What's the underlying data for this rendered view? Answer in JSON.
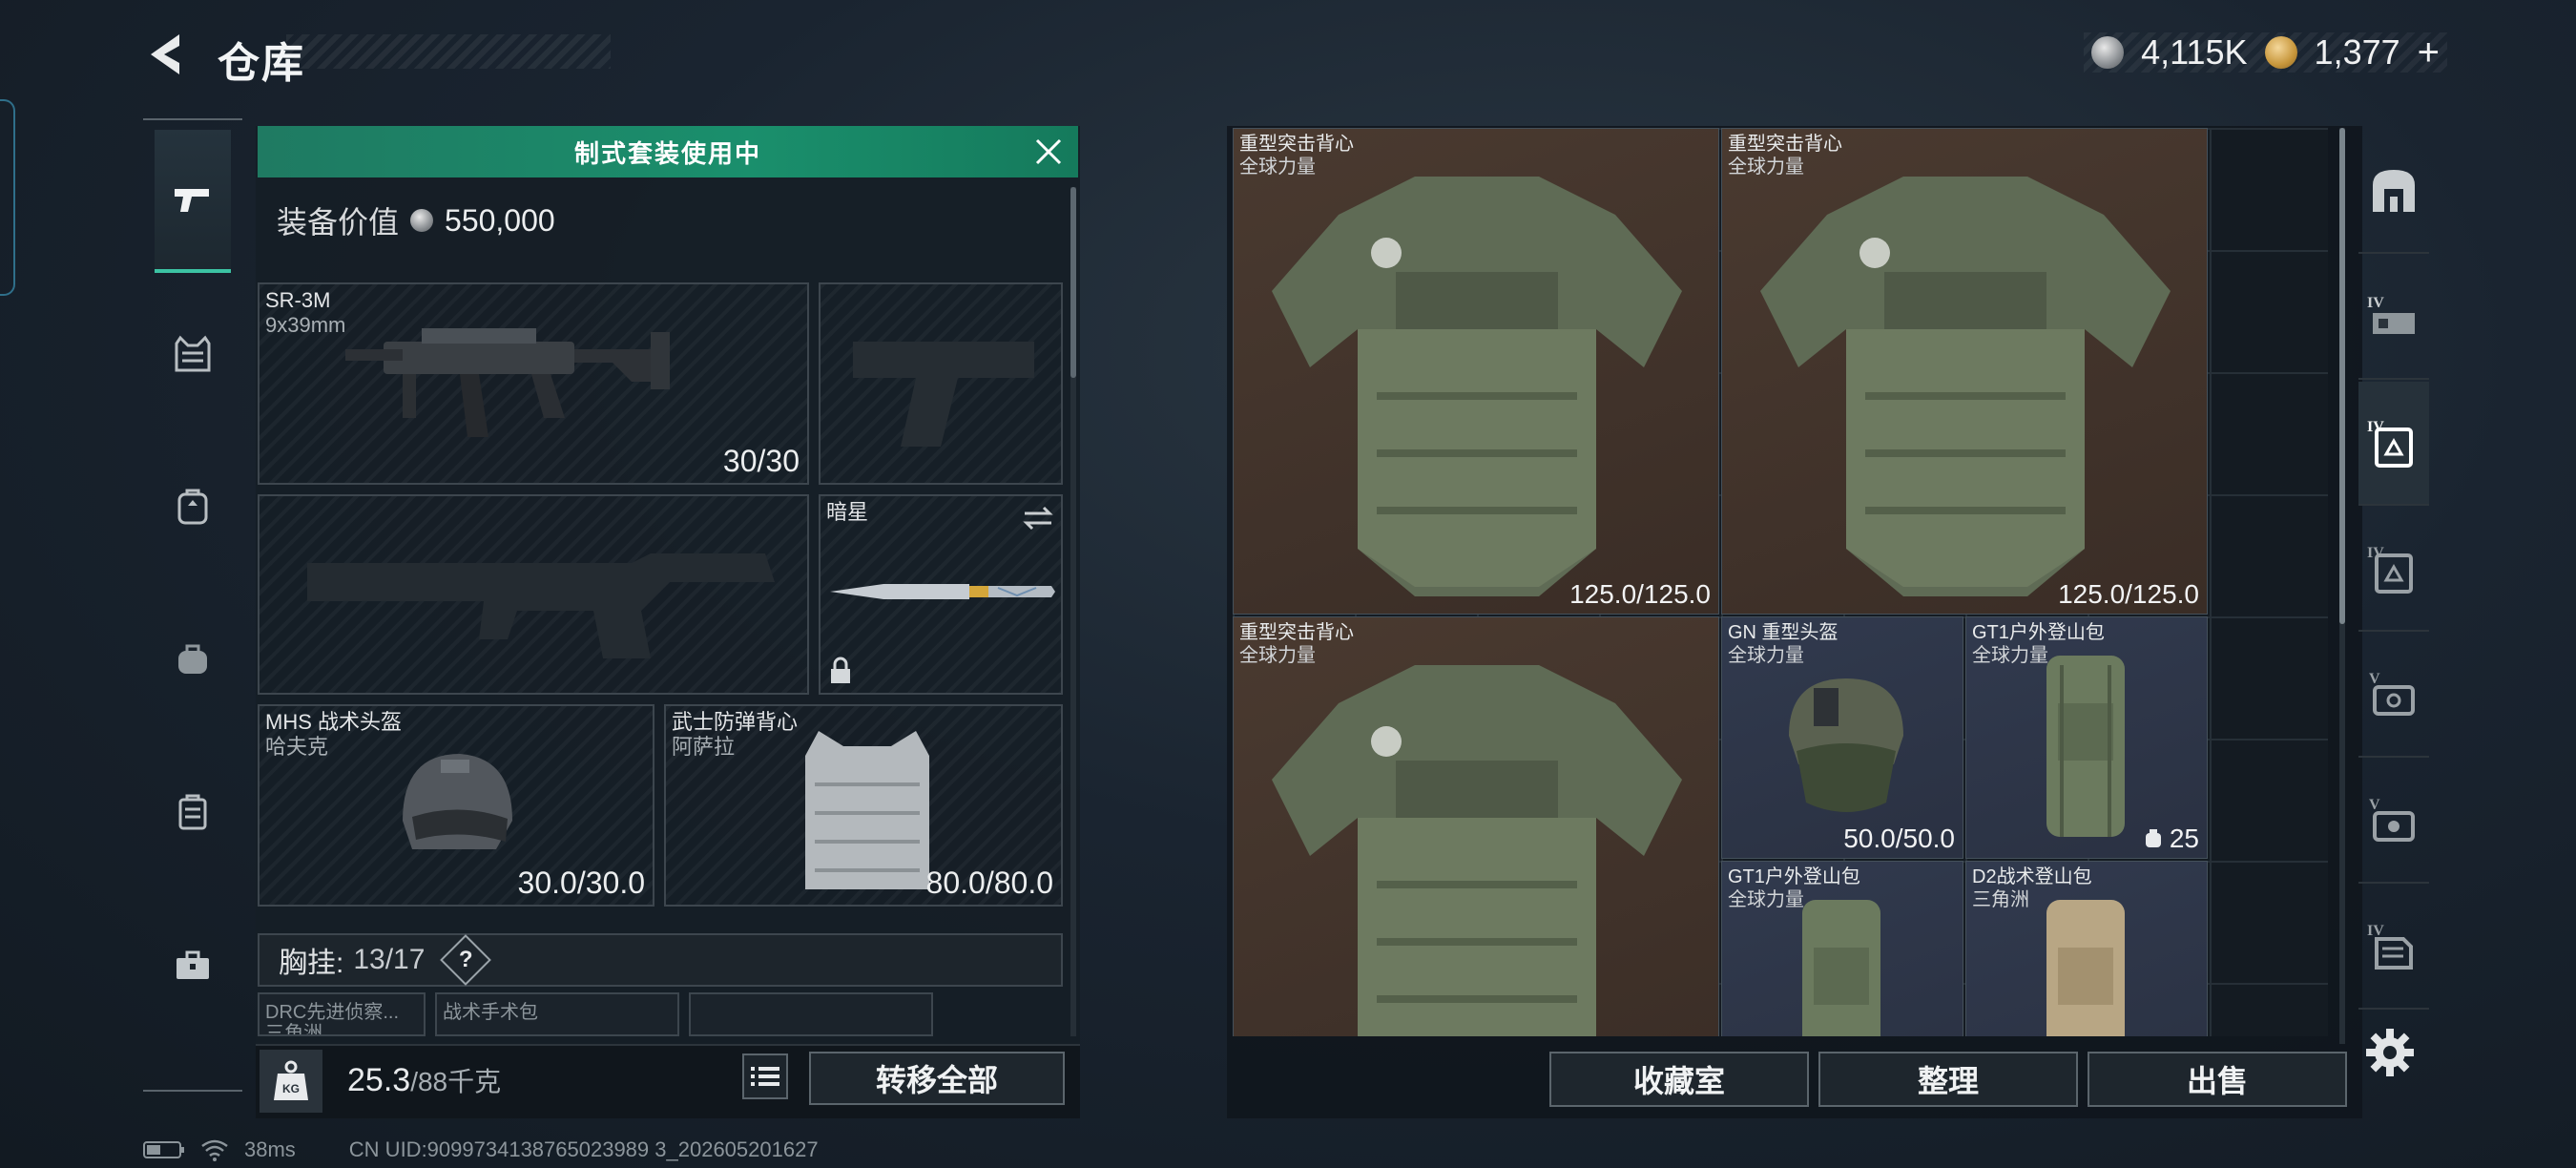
{
  "header": {
    "title": "仓库",
    "currency": [
      {
        "icon": "silver-coin-icon",
        "value": "4,115K"
      },
      {
        "icon": "gold-coin-icon",
        "value": "1,377"
      }
    ],
    "add_label": "+"
  },
  "side_nav": [
    {
      "icon": "pistol-icon",
      "active": true
    },
    {
      "icon": "vest-icon",
      "active": false
    },
    {
      "icon": "backpack-icon",
      "active": false
    },
    {
      "icon": "bag-icon",
      "active": false
    },
    {
      "icon": "case-icon",
      "active": false
    },
    {
      "icon": "toolbox-icon",
      "active": false
    }
  ],
  "loadout": {
    "banner": "制式套装使用中",
    "value_label": "装备价值",
    "value": "550,000",
    "slots": {
      "primary": {
        "name": "SR-3M",
        "sub": "9x39mm",
        "count": "30/30"
      },
      "melee": {
        "name": "暗星"
      },
      "helmet": {
        "name": "MHS 战术头盔",
        "sub": "哈夫克",
        "count": "30.0/30.0"
      },
      "armor": {
        "name": "武士防弹背心",
        "sub": "阿萨拉",
        "count": "80.0/80.0"
      }
    },
    "chest_label": "胸挂:",
    "chest_count": "13/17",
    "help_label": "?",
    "sub_slots": [
      {
        "line1": "DRC先进侦察...",
        "line2": "三角洲"
      },
      {
        "line1": "战术手术包",
        "line2": ""
      }
    ],
    "weight": "25.3",
    "weight_max": "/88千克",
    "weight_icon_label": "KG",
    "transfer_all": "转移全部"
  },
  "storage": {
    "items": [
      {
        "name": "重型突击背心",
        "sub": "全球力量",
        "durability": "125.0/125.0"
      },
      {
        "name": "重型突击背心",
        "sub": "全球力量",
        "durability": "125.0/125.0"
      },
      {
        "name": "重型突击背心",
        "sub": "全球力量",
        "durability": ""
      },
      {
        "name": "GN 重型头盔",
        "sub": "全球力量",
        "durability": "50.0/50.0"
      },
      {
        "name": "GT1户外登山包",
        "sub": "全球力量",
        "qty": "25"
      },
      {
        "name": "GT1户外登山包",
        "sub": "全球力量"
      },
      {
        "name": "D2战术登山包",
        "sub": "三角洲"
      }
    ],
    "buttons": {
      "collection": "收藏室",
      "sort": "整理",
      "sell": "出售"
    }
  },
  "filters": [
    {
      "icon": "all-items-icon",
      "label": ""
    },
    {
      "icon": "rig-filter-icon",
      "label": "IV"
    },
    {
      "icon": "armor-filter-icon",
      "label": "IV"
    },
    {
      "icon": "helmet-filter-icon",
      "label": "IV"
    },
    {
      "icon": "backpack-filter-icon",
      "label": "V"
    },
    {
      "icon": "case-filter-icon",
      "label": "V"
    },
    {
      "icon": "container-filter-icon",
      "label": "IV"
    }
  ],
  "status": {
    "ping": "38ms",
    "uid": "CN UID:9099734138765023989 3_202605201627"
  },
  "colors": {
    "accent": "#1f8a68",
    "brown_slot": "#4a3a30",
    "blue_slot": "#313a4e"
  }
}
